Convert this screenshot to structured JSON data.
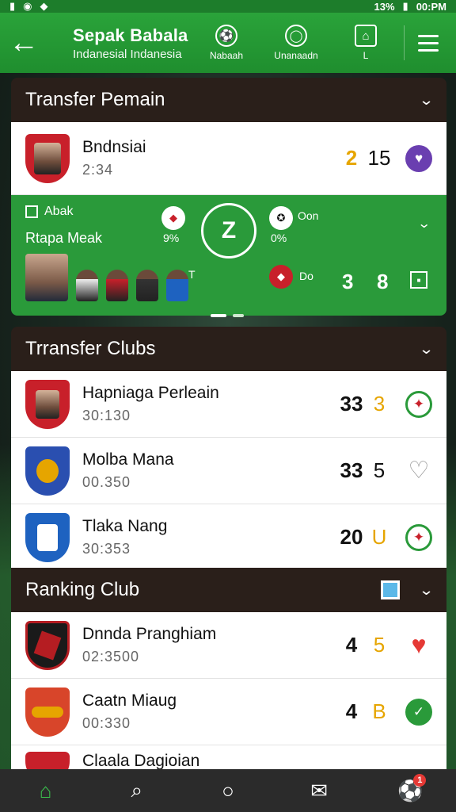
{
  "status_bar": {
    "left_icons": [
      "signal-icon",
      "wifi-icon",
      "notification-icon"
    ],
    "battery": "13%",
    "time": "00:PM"
  },
  "header": {
    "back_glyph": "←",
    "title": "Sepak Babala",
    "subtitle": "Indanesial Indanesia",
    "nav": [
      {
        "label": "Nabaah",
        "icon": "soccer-ball-icon",
        "glyph": "⚽"
      },
      {
        "label": "Unanaadn",
        "icon": "chat-icon",
        "glyph": "◯"
      },
      {
        "label": "L",
        "icon": "club-icon",
        "glyph": "⌂"
      }
    ]
  },
  "transfer_pemain": {
    "title": "Transfer Pemain",
    "rows": [
      {
        "name": "Bndnsiai",
        "time": "2:34",
        "score_a": "2",
        "score_b": "15",
        "icon": "heart-icon",
        "icon_glyph": "♥",
        "accent": "#6a3fb0",
        "crest_color": "#c8202a"
      }
    ],
    "live": {
      "tag": "Abak",
      "subtitle": "Rtapa Meak",
      "center_glyph": "Z",
      "left_pct": "9%",
      "right_pct": "0%",
      "right_label": "Oon",
      "sub_label": "T",
      "bottom_label": "Do",
      "score_a": "3",
      "score_b": "8"
    }
  },
  "transfer_clubs": {
    "title": "Trransfer Clubs",
    "rows": [
      {
        "name": "Hapniaga Perleain",
        "time": "30:130",
        "score_a": "33",
        "score_b": "3",
        "score_b_color": "#e6a500",
        "icon": "club-badge-icon",
        "icon_glyph": "✦",
        "accent": "#2a9a3a",
        "crest_color": "#c8202a"
      },
      {
        "name": "Molba Mana",
        "time": "00.350",
        "score_a": "33",
        "score_b": "5",
        "score_b_color": "#111111",
        "icon": "heart-outline-icon",
        "icon_glyph": "♡",
        "accent": "#999999",
        "crest_color": "#2a4fb0"
      },
      {
        "name": "Tlaka Nang",
        "time": "30:353",
        "score_a": "20",
        "score_b": "U",
        "score_b_color": "#e6a500",
        "icon": "club-badge-icon",
        "icon_glyph": "✦",
        "accent": "#2a9a3a",
        "crest_color": "#1e62c0"
      }
    ]
  },
  "ranking_club": {
    "title": "Ranking Club",
    "rows": [
      {
        "name": "Dnnda Pranghiam",
        "time": "02:3500",
        "score_a": "4",
        "score_b": "5",
        "score_b_color": "#e6a500",
        "icon": "heart-icon",
        "icon_glyph": "♥",
        "accent": "#e53935",
        "crest_color": "#b51d22"
      },
      {
        "name": "Caatn Miaug",
        "time": "00:330",
        "score_a": "4",
        "score_b": "B",
        "score_b_color": "#e6a500",
        "icon": "check-icon",
        "icon_glyph": "✓",
        "accent": "#2a9a3a",
        "crest_color": "#d8452a"
      },
      {
        "name": "Claala Dagioian",
        "time": "",
        "score_a": "",
        "score_b": "",
        "score_b_color": "#111111",
        "icon": "club-badge-icon",
        "icon_glyph": "",
        "accent": "#2a9a3a",
        "crest_color": "#c8202a"
      }
    ]
  },
  "tab_bar": [
    {
      "name": "home-icon",
      "glyph": "⌂",
      "active": true
    },
    {
      "name": "search-icon",
      "glyph": "⌕",
      "active": false
    },
    {
      "name": "circle-icon",
      "glyph": "○",
      "active": false
    },
    {
      "name": "mail-icon",
      "glyph": "✉",
      "active": false
    },
    {
      "name": "ball-icon",
      "glyph": "⚽",
      "active": false,
      "badge": "1"
    }
  ]
}
